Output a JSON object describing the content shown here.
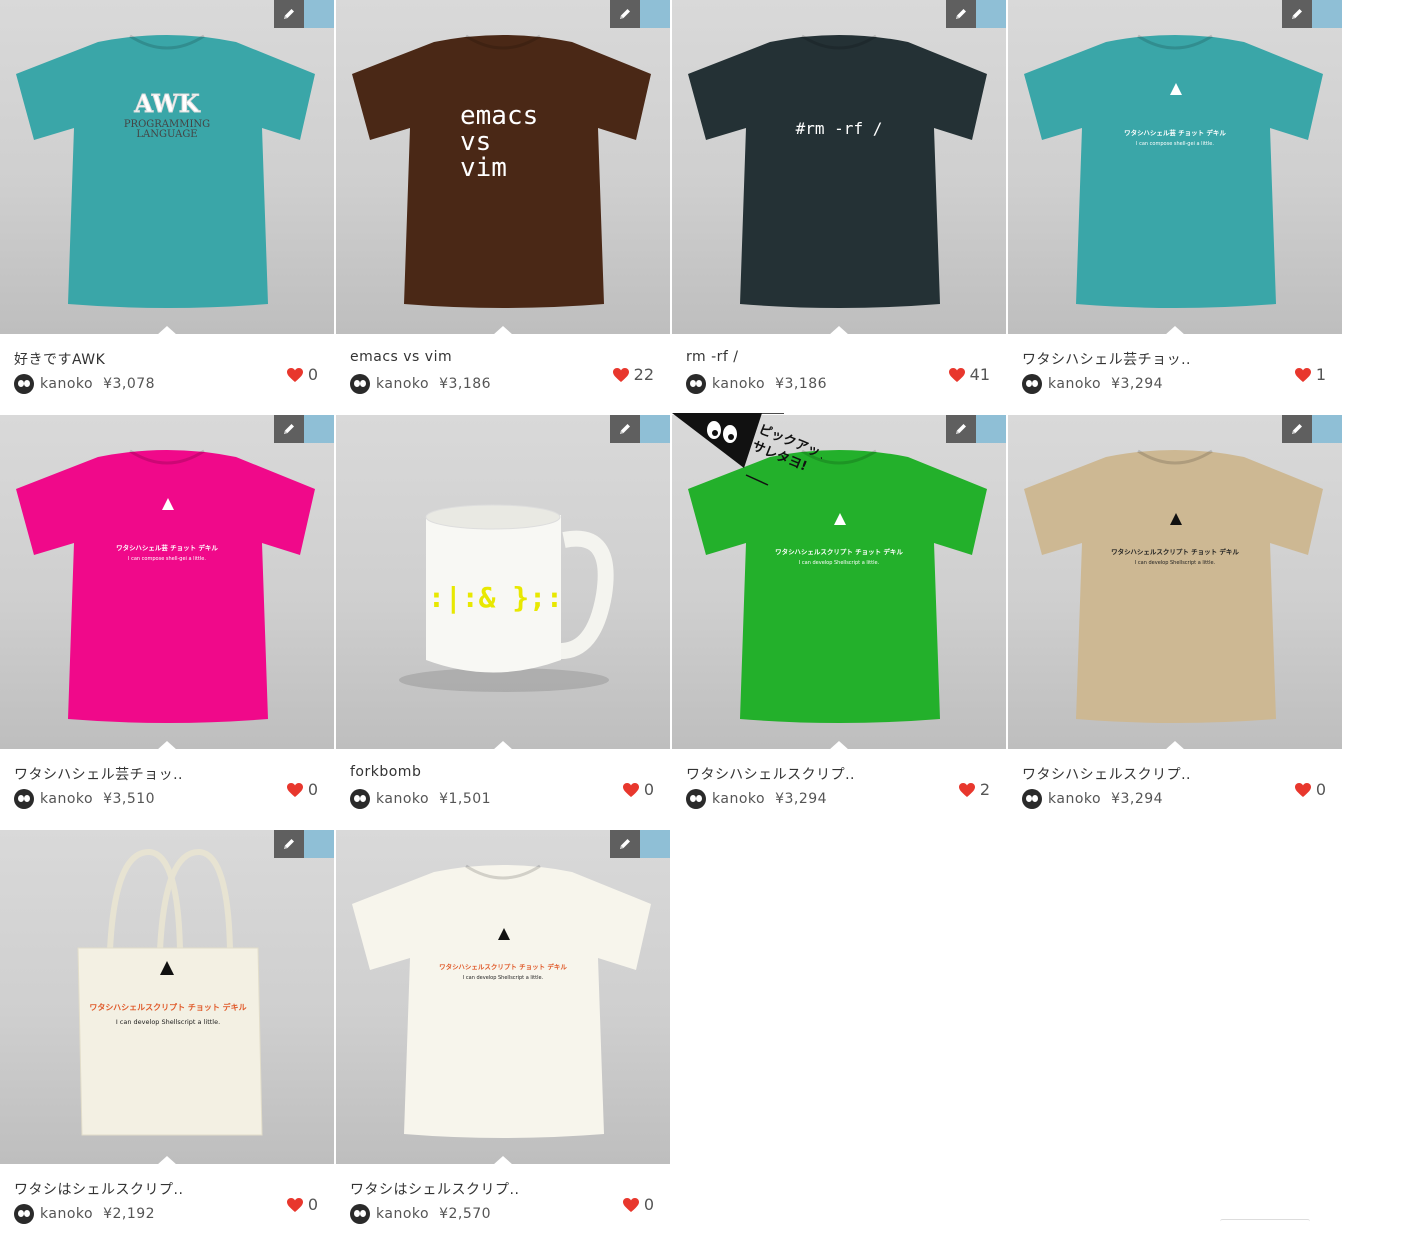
{
  "products": [
    {
      "title": "好きですAWK",
      "user": "kanoko",
      "price": "¥3,078",
      "likes": "0",
      "kind": "tshirt",
      "color": "#3aa6a8",
      "design": "awk",
      "art": {
        "main": "AWK",
        "sub1": "PROGRAMMING",
        "sub2": "LANGUAGE"
      }
    },
    {
      "title": "emacs vs vim",
      "user": "kanoko",
      "price": "¥3,186",
      "likes": "22",
      "kind": "tshirt",
      "color": "#4a2816",
      "design": "emacs",
      "art": {
        "l1": "emacs",
        "l2": "vs",
        "l3": "vim"
      }
    },
    {
      "title": "rm -rf /",
      "user": "kanoko",
      "price": "¥3,186",
      "likes": "41",
      "kind": "tshirt",
      "color": "#243135",
      "design": "rmrf",
      "art": {
        "main": "#rm -rf /"
      }
    },
    {
      "title": "ワタシハシェル芸チョッ..",
      "user": "kanoko",
      "price": "¥3,294",
      "likes": "1",
      "kind": "tshirt",
      "color": "#3aa6a8",
      "design": "shell",
      "art": {
        "jp": "ワタシハシェル芸 チョット デキル",
        "en": "I can compose shell-gei a little."
      }
    },
    {
      "title": "ワタシハシェル芸チョッ..",
      "user": "kanoko",
      "price": "¥3,510",
      "likes": "0",
      "kind": "tshirt",
      "color": "#f0098a",
      "design": "shell",
      "art": {
        "jp": "ワタシハシェル芸 チョット デキル",
        "en": "I can compose shell-gei a little."
      }
    },
    {
      "title": "forkbomb",
      "user": "kanoko",
      "price": "¥1,501",
      "likes": "0",
      "kind": "mug",
      "color": "#ffffff",
      "design": "fork",
      "art": {
        "main": ":|:& };:"
      }
    },
    {
      "title": "ワタシハシェルスクリプ..",
      "user": "kanoko",
      "price": "¥3,294",
      "likes": "2",
      "kind": "tshirt",
      "color": "#23b02b",
      "design": "script",
      "art": {
        "jp": "ワタシハシェルスクリプト チョット デキル",
        "en": "I can develop Shellscript a little."
      }
    },
    {
      "title": "ワタシハシェルスクリプ..",
      "user": "kanoko",
      "price": "¥3,294",
      "likes": "0",
      "kind": "tshirt",
      "color": "#cdb893",
      "design": "script",
      "art": {
        "jp": "ワタシハシェルスクリプト チョット デキル",
        "en": "I can develop Shellscript a little."
      }
    },
    {
      "title": "ワタシはシェルスクリプ..",
      "user": "kanoko",
      "price": "¥2,192",
      "likes": "0",
      "kind": "tote",
      "color": "#f3f0e3",
      "design": "script",
      "art": {
        "jp": "ワタシハシェルスクリプト チョット デキル",
        "en": "I can develop Shellscript a little."
      }
    },
    {
      "title": "ワタシはシェルスクリプ..",
      "user": "kanoko",
      "price": "¥2,570",
      "likes": "0",
      "kind": "tshirt",
      "color": "#f7f5ec",
      "design": "script",
      "art": {
        "jp": "ワタシハシェルスクリプト チョット デキル",
        "en": "I can develop Shellscript a little."
      }
    }
  ],
  "pickup": {
    "line1": "ピックアップ",
    "line2": "サレタヨ!"
  },
  "colors": {
    "heart": "#e8372d",
    "edit_bg": "#5f5f5f",
    "blue_tab": "#8fbfd6"
  },
  "icons": {
    "edit": "pencil-icon",
    "like": "heart-icon",
    "avatar": "avatar-eyes"
  }
}
